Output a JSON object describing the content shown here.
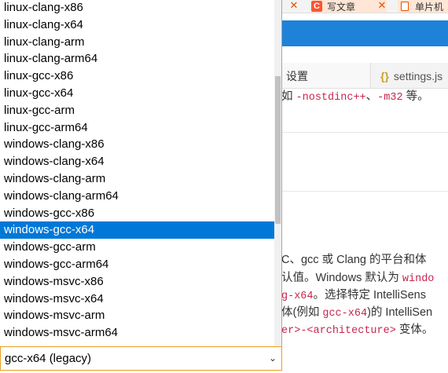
{
  "background": {
    "tabs": [
      {
        "label": "写文章",
        "icon": "csdn-icon"
      },
      {
        "label": "单片机",
        "icon": "document-icon"
      }
    ],
    "subtabs": {
      "active": "设置",
      "inactive": "settings.js"
    },
    "desc_top": {
      "prefix": "如 ",
      "code1": "-nostdinc++",
      "sep": "、",
      "code2": "-m32",
      "suffix": " 等。"
    },
    "desc_lines": [
      [
        {
          "t": "C、gcc 或 Clang 的平台和体"
        }
      ],
      [
        {
          "t": "认值。Windows 默认为 "
        },
        {
          "t": "windo",
          "c": "red"
        }
      ],
      [
        {
          "t": "g-x64",
          "c": "red"
        },
        {
          "t": "。选择特定 IntelliSens"
        }
      ],
      [
        {
          "t": "体(例如 "
        },
        {
          "t": "gcc-x64",
          "c": "red"
        },
        {
          "t": ")的 IntelliSen"
        }
      ],
      [
        {
          "t": "er>",
          "c": "red"
        },
        {
          "t": "-<architecture>",
          "c": "red"
        },
        {
          "t": " 变体。"
        }
      ]
    ]
  },
  "dropdown": {
    "options": [
      "linux-clang-x86",
      "linux-clang-x64",
      "linux-clang-arm",
      "linux-clang-arm64",
      "linux-gcc-x86",
      "linux-gcc-x64",
      "linux-gcc-arm",
      "linux-gcc-arm64",
      "windows-clang-x86",
      "windows-clang-x64",
      "windows-clang-arm",
      "windows-clang-arm64",
      "windows-gcc-x86",
      "windows-gcc-x64",
      "windows-gcc-arm",
      "windows-gcc-arm64",
      "windows-msvc-x86",
      "windows-msvc-x64",
      "windows-msvc-arm",
      "windows-msvc-arm64"
    ],
    "highlighted_index": 13,
    "selected_value": "gcc-x64 (legacy)"
  },
  "colors": {
    "highlight": "#0078d7",
    "accent_blue": "#1e82d8",
    "select_border": "#e8a020",
    "code_red": "#c7254e"
  }
}
